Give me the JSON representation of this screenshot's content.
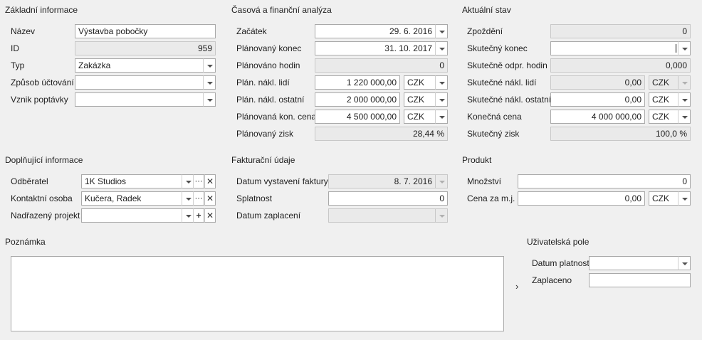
{
  "basic": {
    "title": "Základní informace",
    "name_label": "Název",
    "name_value": "Výstavba pobočky",
    "id_label": "ID",
    "id_value": "959",
    "type_label": "Typ",
    "type_value": "Zakázka",
    "accounting_label": "Způsob účtování",
    "accounting_value": "",
    "origin_label": "Vznik poptávky",
    "origin_value": ""
  },
  "timefin": {
    "title": "Časová a finanční analýza",
    "start_label": "Začátek",
    "start_value": "29. 6. 2016",
    "planned_end_label": "Plánovaný konec",
    "planned_end_value": "31. 10. 2017",
    "planned_hours_label": "Plánováno hodin",
    "planned_hours_value": "0",
    "plan_people_label": "Plán. nákl. lidí",
    "plan_people_value": "1 220 000,00",
    "plan_people_cur": "CZK",
    "plan_other_label": "Plán. nákl. ostatní",
    "plan_other_value": "2 000 000,00",
    "plan_other_cur": "CZK",
    "plan_price_label": "Plánovaná kon. cena",
    "plan_price_value": "4 500 000,00",
    "plan_price_cur": "CZK",
    "plan_profit_label": "Plánovaný zisk",
    "plan_profit_value": "28,44 %"
  },
  "current": {
    "title": "Aktuální stav",
    "delay_label": "Zpoždění",
    "delay_value": "0",
    "actual_end_label": "Skutečný konec",
    "actual_end_value": "",
    "actual_hours_label": "Skutečně odpr. hodin",
    "actual_hours_value": "0,000",
    "actual_people_label": "Skutečné nákl. lidí",
    "actual_people_value": "0,00",
    "actual_people_cur": "CZK",
    "actual_other_label": "Skutečné nákl. ostatní",
    "actual_other_value": "0,00",
    "actual_other_cur": "CZK",
    "final_price_label": "Konečná cena",
    "final_price_value": "4 000 000,00",
    "final_price_cur": "CZK",
    "actual_profit_label": "Skutečný zisk",
    "actual_profit_value": "100,0 %"
  },
  "extra": {
    "title": "Doplňující informace",
    "customer_label": "Odběratel",
    "customer_value": "1K Studios",
    "contact_label": "Kontaktní osoba",
    "contact_value": "Kučera, Radek",
    "parent_label": "Nadřazený projekt",
    "parent_value": ""
  },
  "billing": {
    "title": "Fakturační údaje",
    "invoice_date_label": "Datum vystavení faktury",
    "invoice_date_value": "8. 7. 2016",
    "due_label": "Splatnost",
    "due_value": "0",
    "paid_date_label": "Datum zaplacení",
    "paid_date_value": ""
  },
  "product": {
    "title": "Produkt",
    "qty_label": "Množství",
    "qty_value": "0",
    "unit_price_label": "Cena za m.j.",
    "unit_price_value": "0,00",
    "unit_price_cur": "CZK"
  },
  "note": {
    "title": "Poznámka"
  },
  "user": {
    "title": "Uživatelská pole",
    "valid_label": "Datum platnosti",
    "valid_value": "",
    "paid_label": "Zaplaceno",
    "paid_value": ""
  },
  "icons": {
    "more": "⋯",
    "clear": "✕",
    "add": "+",
    "expand": "›"
  }
}
